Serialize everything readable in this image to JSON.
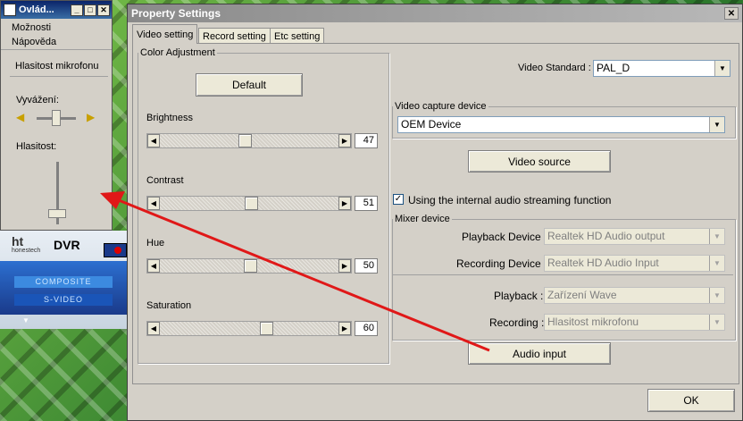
{
  "volume_window": {
    "title": "Ovlád...",
    "menu": [
      "Možnosti",
      "Nápověda"
    ],
    "device_label": "Hlasitost mikrofonu",
    "balance_label": "Vyvážení:",
    "volume_label": "Hlasitost:"
  },
  "dvr": {
    "logo_text": "honestech",
    "brand": "DVR",
    "inputs": [
      "COMPOSITE",
      "S-VIDEO"
    ]
  },
  "dialog": {
    "title": "Property Settings",
    "tabs": [
      "Video setting",
      "Record setting",
      "Etc setting"
    ],
    "color_adjustment": {
      "legend": "Color Adjustment",
      "default_button": "Default",
      "sliders": [
        {
          "label": "Brightness",
          "value": "47",
          "level": 0.47
        },
        {
          "label": "Contrast",
          "value": "51",
          "level": 0.51
        },
        {
          "label": "Hue",
          "value": "50",
          "level": 0.5
        },
        {
          "label": "Saturation",
          "value": "60",
          "level": 0.6
        }
      ]
    },
    "video_standard": {
      "label": "Video Standard :",
      "value": "PAL_D"
    },
    "capture": {
      "legend": "Video capture device",
      "device": "OEM Device",
      "source_button": "Video source"
    },
    "audio_stream": {
      "label": "Using the internal audio streaming function",
      "checked": true
    },
    "mixer": {
      "legend": "Mixer device",
      "playback_device_label": "Playback Device :",
      "playback_device": "Realtek HD Audio output",
      "recording_device_label": "Recording Device :",
      "recording_device": "Realtek HD Audio Input",
      "playback_label": "Playback :",
      "playback": "Zařízení Wave",
      "recording_label": "Recording :",
      "recording": "Hlasitost mikrofonu"
    },
    "audio_input_button": "Audio input",
    "ok_button": "OK"
  }
}
